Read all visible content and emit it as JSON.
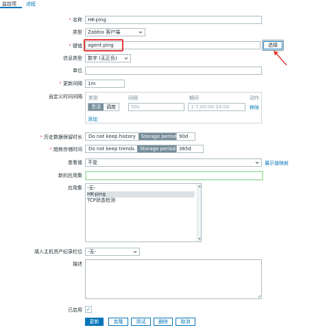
{
  "tabs": [
    {
      "label": "监控项"
    },
    {
      "label": "进程"
    }
  ],
  "form": {
    "name": {
      "label": "名称",
      "value": "HK-ping"
    },
    "type": {
      "label": "类型",
      "value": "Zabbix 客户端"
    },
    "key": {
      "label": "键值",
      "value": "agent.ping",
      "button": "选择"
    },
    "info_type": {
      "label": "信息类型",
      "value": "数字 (无正负)"
    },
    "units": {
      "label": "单位",
      "value": ""
    },
    "interval": {
      "label": "更新间隔",
      "value": "1m"
    },
    "custom_intervals": {
      "label": "自定义时间间隔",
      "headers": {
        "type": "类型",
        "interval": "间隔",
        "period": "期间",
        "action": "动作"
      },
      "row": {
        "flex": "灵活",
        "schedule": "调度",
        "interval_placeholder": "50s",
        "period_placeholder": "1-7,00:00-24:00",
        "remove": "移除"
      },
      "add": "添加"
    },
    "history": {
      "label": "历史数据保留时长",
      "opt1": "Do not keep history",
      "opt2": "Storage period",
      "value": "90d"
    },
    "trends": {
      "label": "趋势存储时间",
      "opt1": "Do not keep trends",
      "opt2": "Storage period",
      "value": "365d"
    },
    "show_value": {
      "label": "查看值",
      "value": "不变",
      "link": "展示值映射"
    },
    "new_app": {
      "label": "新的应用集",
      "value": ""
    },
    "apps": {
      "label": "应用集",
      "items": [
        "-无-",
        "HK-ping",
        "TCP状态检测"
      ]
    },
    "inventory": {
      "label": "填入主机资产纪录栏位",
      "value": "-无-"
    },
    "description": {
      "label": "描述",
      "value": ""
    },
    "enabled": {
      "label": "已启用",
      "checkmark": "✓"
    }
  },
  "buttons": {
    "update": "更新",
    "clone": "克隆",
    "test": "测试",
    "delete": "删除",
    "cancel": "取消"
  },
  "colors": {
    "accent": "#0275b8",
    "highlight": "#e53935"
  }
}
